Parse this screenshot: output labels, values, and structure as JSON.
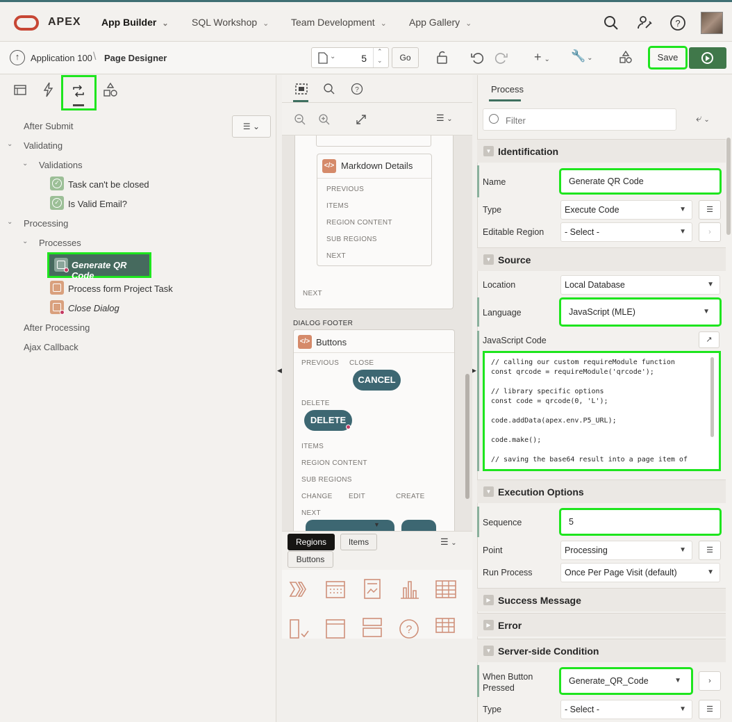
{
  "brand": {
    "name": "APEX",
    "logo_color": "#c74634"
  },
  "topnav": [
    {
      "label": "App Builder",
      "active": true
    },
    {
      "label": "SQL Workshop"
    },
    {
      "label": "Team Development"
    },
    {
      "label": "App Gallery"
    }
  ],
  "icons": [
    "search-icon",
    "admin-wrench-icon",
    "help-icon",
    "user-avatar"
  ],
  "breadcrumb": {
    "app": "Application 100",
    "page": "Page Designer"
  },
  "toolbar": {
    "page_number": "5",
    "go_label": "Go",
    "save_label": "Save",
    "run_color": "#40784a"
  },
  "left": {
    "tabs": [
      "rendering-tab",
      "dynamic-actions-tab",
      "processing-tab",
      "shared-components-tab"
    ],
    "tree": {
      "after_submit": "After Submit",
      "validating": "Validating",
      "validations": "Validations",
      "validation_items": [
        "Task can't be closed",
        "Is Valid Email?"
      ],
      "processing": "Processing",
      "processes": "Processes",
      "selected_process": "Generate QR Code",
      "process_items": [
        "Process form Project Task",
        "Close Dialog"
      ],
      "after_processing": "After Processing",
      "ajax_callback": "Ajax Callback"
    }
  },
  "canvas": {
    "card1": {
      "title": "Markdown Details",
      "slots": [
        "PREVIOUS",
        "ITEMS",
        "REGION CONTENT",
        "SUB REGIONS",
        "NEXT"
      ]
    },
    "outer_next": "NEXT",
    "footer_label": "DIALOG FOOTER",
    "card2": {
      "title": "Buttons",
      "previous": "PREVIOUS",
      "close": "CLOSE",
      "cancel_btn": "CANCEL",
      "delete_slot": "DELETE",
      "delete_btn": "DELETE",
      "items": "ITEMS",
      "region_content": "REGION CONTENT",
      "sub_regions": "SUB REGIONS",
      "change": "CHANGE",
      "edit": "EDIT",
      "create": "CREATE",
      "next": "NEXT"
    },
    "gallery_tabs": [
      "Regions",
      "Items",
      "Buttons"
    ]
  },
  "props": {
    "tab": "Process",
    "filter_placeholder": "Filter",
    "identification": {
      "title": "Identification",
      "name_label": "Name",
      "name_value": "Generate QR Code",
      "type_label": "Type",
      "type_value": "Execute Code",
      "editable_label": "Editable Region",
      "editable_value": "- Select -"
    },
    "source": {
      "title": "Source",
      "location_label": "Location",
      "location_value": "Local Database",
      "language_label": "Language",
      "language_value": "JavaScript (MLE)",
      "code_label": "JavaScript Code",
      "code": "// calling our custom requireModule function\nconst qrcode = requireModule('qrcode');\n\n// library specific options\nconst code = qrcode(0, 'L');\n\ncode.addData(apex.env.P5_URL);\n\ncode.make();\n\n// saving the base64 result into a page item of"
    },
    "execution": {
      "title": "Execution Options",
      "sequence_label": "Sequence",
      "sequence_value": "5",
      "point_label": "Point",
      "point_value": "Processing",
      "run_label": "Run Process",
      "run_value": "Once Per Page Visit (default)"
    },
    "success_title": "Success Message",
    "error_title": "Error",
    "condition": {
      "title": "Server-side Condition",
      "button_label": "When Button Pressed",
      "button_value": "Generate_QR_Code",
      "type_label": "Type",
      "type_value": "- Select -"
    }
  },
  "highlight_color": "#1ee51e"
}
